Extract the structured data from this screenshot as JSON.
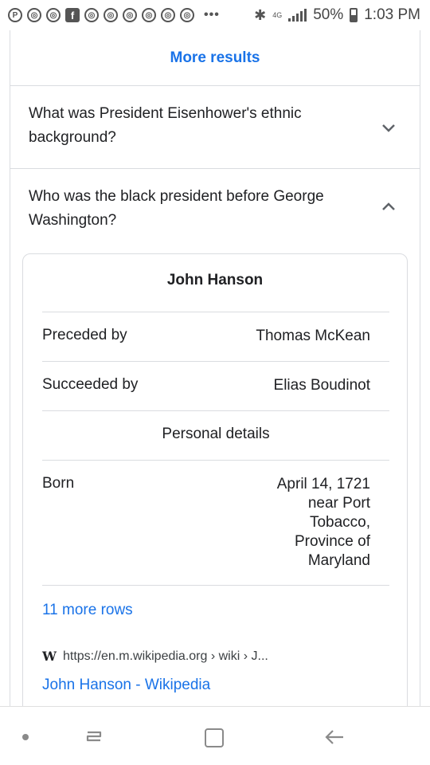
{
  "status_bar": {
    "time": "1:03 PM",
    "battery": "50%",
    "network_label": "4G",
    "overflow": "•••"
  },
  "more_results": {
    "label": "More results"
  },
  "faq": [
    {
      "question": "What was President Eisenhower's ethnic background?",
      "state": "collapsed"
    },
    {
      "question": "Who was the black president before George Washington?",
      "state": "expanded"
    }
  ],
  "knowledge_panel": {
    "title": "John Hanson",
    "rows": [
      {
        "label": "Preceded by",
        "value": "Thomas McKean"
      },
      {
        "label": "Succeeded by",
        "value": "Elias Boudinot"
      }
    ],
    "section": "Personal details",
    "born": {
      "label": "Born",
      "value": "April 14, 1721\nnear Port\nTobacco,\nProvince of\nMaryland"
    },
    "more_rows": "11 more rows",
    "source_url": "https://en.m.wikipedia.org › wiki › J...",
    "source_title": "John Hanson - Wikipedia",
    "source_icon": "W"
  }
}
